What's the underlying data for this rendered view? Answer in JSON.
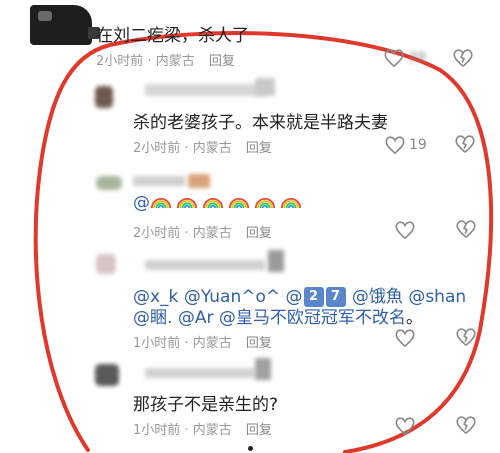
{
  "comments": [
    {
      "text": "在刘二疙梁，杀人了",
      "time": "2小时前",
      "location": "内蒙古",
      "reply": "回复",
      "likes": "39"
    },
    {
      "text": "杀的老婆孩子。本来就是半路夫妻",
      "time": "2小时前",
      "location": "内蒙古",
      "reply": "回复",
      "likes": "19"
    },
    {
      "text_prefix": "@",
      "time": "2小时前",
      "location": "内蒙古",
      "reply": "回复"
    },
    {
      "line1": [
        "@x_k",
        "@Yuan^o^",
        "@",
        "@饿魚",
        "@shan"
      ],
      "line1_boxes": [
        "2",
        "7"
      ],
      "line2": [
        "@睏.",
        "@Ar",
        "@皇马不欧冠冠军不改名"
      ],
      "line2_suffix": "。",
      "time": "1小时前",
      "location": "内蒙古",
      "reply": "回复"
    },
    {
      "text": "那孩子不是亲生的?",
      "time": "1小时前",
      "location": "内蒙古",
      "reply": "回复"
    }
  ],
  "separator": "·",
  "colors": {
    "annotation_red": "#e0392b",
    "mention_blue": "#2f5fa8",
    "meta_gray": "#9a9a9a"
  },
  "icons": [
    "heart-icon",
    "broken-heart-icon",
    "rainbow-emoji-icon"
  ]
}
